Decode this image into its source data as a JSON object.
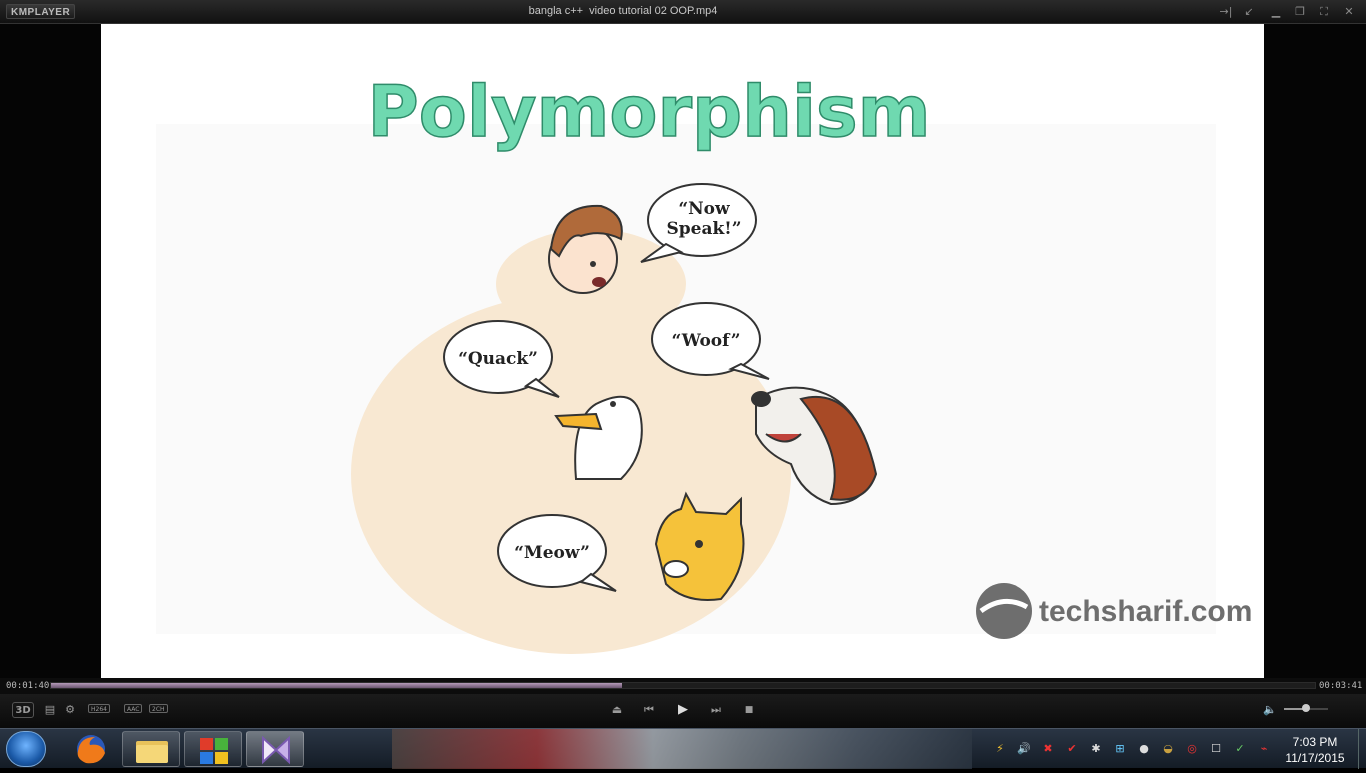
{
  "player": {
    "logo_text": "KMPLAYER",
    "title": "bangla c++  video tutorial 02 OOP.mp4",
    "window_icons": {
      "pin": "→|",
      "mini": "↙",
      "minimize": "▁",
      "restore": "❐",
      "maximize": "⛶",
      "close": "✕"
    }
  },
  "video": {
    "heading": "Polymorphism",
    "bubbles": {
      "boy": "“Now\nSpeak!”",
      "duck": "“Quack”",
      "dog": "“Woof”",
      "cat": "“Meow”"
    },
    "watermark": "techsharif.com",
    "colors": {
      "heading": "#6fd9b0",
      "blob": "#f8e8d2"
    }
  },
  "seek": {
    "elapsed": "00:01:40",
    "total": "00:03:41",
    "progress": 0.452
  },
  "controls": {
    "left_button": "3D",
    "badges": [
      "H264",
      "AAC",
      "2CH"
    ],
    "icons": {
      "playlist": "▤",
      "settings": "⚙",
      "eject": "⏏",
      "prev": "⏮",
      "play": "▶",
      "next": "⏭",
      "stop": "■",
      "volume": "🔈"
    },
    "volume_level": 0.5
  },
  "taskbar": {
    "clock_time": "7:03 PM",
    "clock_date": "11/17/2015",
    "tray_icons": [
      "⚡",
      "🔊",
      "✖",
      "✔",
      "✱",
      "⊞",
      "●",
      "◒",
      "◎",
      "◐",
      "☐",
      "✓",
      "⌁"
    ]
  }
}
